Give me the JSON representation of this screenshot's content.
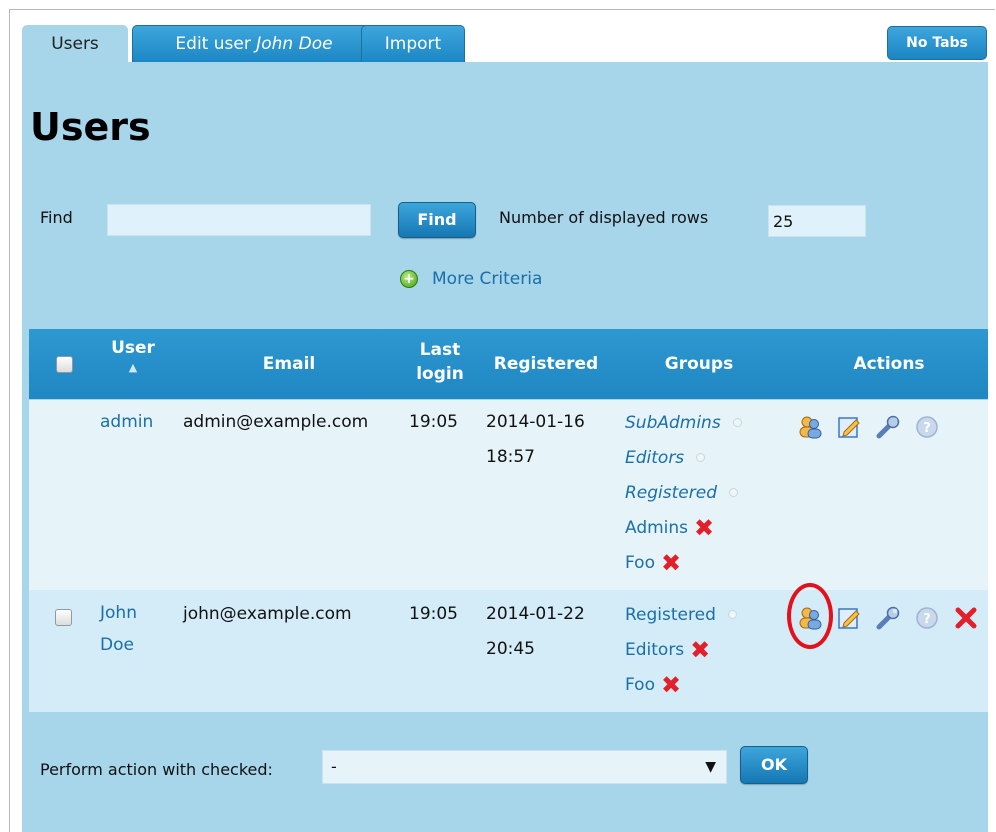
{
  "tabs": {
    "users": "Users",
    "edit_prefix": "Edit user ",
    "edit_name": "John Doe",
    "import": "Import"
  },
  "notabs_label": "No Tabs",
  "page_title": "Users",
  "search": {
    "find_label": "Find",
    "find_value": "",
    "find_button": "Find",
    "rows_label": "Number of displayed rows",
    "rows_value": "25",
    "more_criteria": "More Criteria"
  },
  "table": {
    "headers": {
      "user": "User",
      "email": "Email",
      "last_login_1": "Last",
      "last_login_2": "login",
      "registered": "Registered",
      "groups": "Groups",
      "actions": "Actions"
    },
    "rows": [
      {
        "user": "admin",
        "email": "admin@example.com",
        "last_login": "19:05",
        "registered_date": "2014-01-16",
        "registered_time": "18:57",
        "groups": [
          "SubAdmins",
          "Editors",
          "Registered",
          "Admins",
          "Foo"
        ]
      },
      {
        "user_1": "John",
        "user_2": "Doe",
        "email": "john@example.com",
        "last_login": "19:05",
        "registered_date": "2014-01-22",
        "registered_time": "20:45",
        "groups": [
          "Registered",
          "Editors",
          "Foo"
        ]
      }
    ]
  },
  "bulk": {
    "label": "Perform action with checked:",
    "selected": "-",
    "ok_button": "OK"
  },
  "colors": {
    "panel": "#a7d5ea",
    "header": "#1f87c2",
    "link": "#1a6fa8",
    "highlight": "#e1121b"
  }
}
